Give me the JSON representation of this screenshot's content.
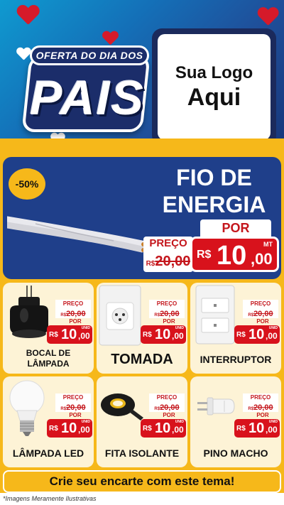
{
  "header": {
    "badge_top": "OFERTA DO DIA DOS",
    "badge_word": "PAIS",
    "logo_line1": "Sua Logo",
    "logo_line2": "Aqui"
  },
  "hero": {
    "discount": "-50%",
    "title_line1": "FIO DE",
    "title_line2": "ENERGIA",
    "por_label": "POR",
    "preco_label": "PREÇO",
    "old_currency": "R$",
    "old_price": "20,00",
    "currency": "R$",
    "price_int": "10",
    "price_dec": ",00",
    "unit": "MT"
  },
  "products": [
    {
      "name": "BOCAL DE LÂMPADA",
      "preco_label": "PREÇO",
      "old_currency": "R$",
      "old_price": "20,00",
      "por_label": "POR",
      "currency": "R$",
      "price_int": "10",
      "price_dec": ",00",
      "unit": "UNID"
    },
    {
      "name": "TOMADA",
      "preco_label": "PREÇO",
      "old_currency": "R$",
      "old_price": "20,00",
      "por_label": "POR",
      "currency": "R$",
      "price_int": "10",
      "price_dec": ",00",
      "unit": "UNID"
    },
    {
      "name": "INTERRUPTOR",
      "preco_label": "PREÇO",
      "old_currency": "R$",
      "old_price": "20,00",
      "por_label": "POR",
      "currency": "R$",
      "price_int": "10",
      "price_dec": ",00",
      "unit": "UNID"
    },
    {
      "name": "LÂMPADA LED",
      "preco_label": "PREÇO",
      "old_currency": "R$",
      "old_price": "20,00",
      "por_label": "POR",
      "currency": "R$",
      "price_int": "10",
      "price_dec": ",00",
      "unit": "UNID"
    },
    {
      "name": "FITA ISOLANTE",
      "preco_label": "PREÇO",
      "old_currency": "R$",
      "old_price": "20,00",
      "por_label": "POR",
      "currency": "R$",
      "price_int": "10",
      "price_dec": ",00",
      "unit": "UNID"
    },
    {
      "name": "PINO MACHO",
      "preco_label": "PREÇO",
      "old_currency": "R$",
      "old_price": "20,00",
      "por_label": "POR",
      "currency": "R$",
      "price_int": "10",
      "price_dec": ",00",
      "unit": "UNID"
    }
  ],
  "footer": {
    "cta": "Crie seu encarte com este tema!",
    "disclaimer": "*Imagens Meramente Ilustrativas"
  },
  "colors": {
    "blue": "#1f3f8a",
    "yellow": "#f6b81a",
    "red": "#d8121c",
    "cream": "#fdf3d6"
  }
}
